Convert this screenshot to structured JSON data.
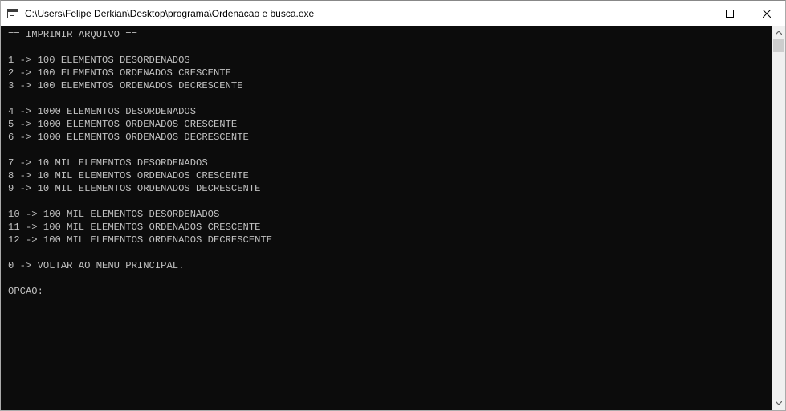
{
  "window": {
    "title": "C:\\Users\\Felipe Derkian\\Desktop\\programa\\Ordenacao e busca.exe",
    "icon": "console-app-icon",
    "controls": [
      "minimize-icon",
      "maximize-icon",
      "close-icon"
    ]
  },
  "console": {
    "lines": [
      "== IMPRIMIR ARQUIVO ==",
      "",
      "1 -> 100 ELEMENTOS DESORDENADOS",
      "2 -> 100 ELEMENTOS ORDENADOS CRESCENTE",
      "3 -> 100 ELEMENTOS ORDENADOS DECRESCENTE",
      "",
      "4 -> 1000 ELEMENTOS DESORDENADOS",
      "5 -> 1000 ELEMENTOS ORDENADOS CRESCENTE",
      "6 -> 1000 ELEMENTOS ORDENADOS DECRESCENTE",
      "",
      "7 -> 10 MIL ELEMENTOS DESORDENADOS",
      "8 -> 10 MIL ELEMENTOS ORDENADOS CRESCENTE",
      "9 -> 10 MIL ELEMENTOS ORDENADOS DECRESCENTE",
      "",
      "10 -> 100 MIL ELEMENTOS DESORDENADOS",
      "11 -> 100 MIL ELEMENTOS ORDENADOS CRESCENTE",
      "12 -> 100 MIL ELEMENTOS ORDENADOS DECRESCENTE",
      "",
      "0 -> VOLTAR AO MENU PRINCIPAL.",
      "",
      "OPCAO:"
    ]
  },
  "colors": {
    "console_bg": "#0c0c0c",
    "console_text": "#c0c0c0",
    "titlebar_bg": "#ffffff"
  }
}
